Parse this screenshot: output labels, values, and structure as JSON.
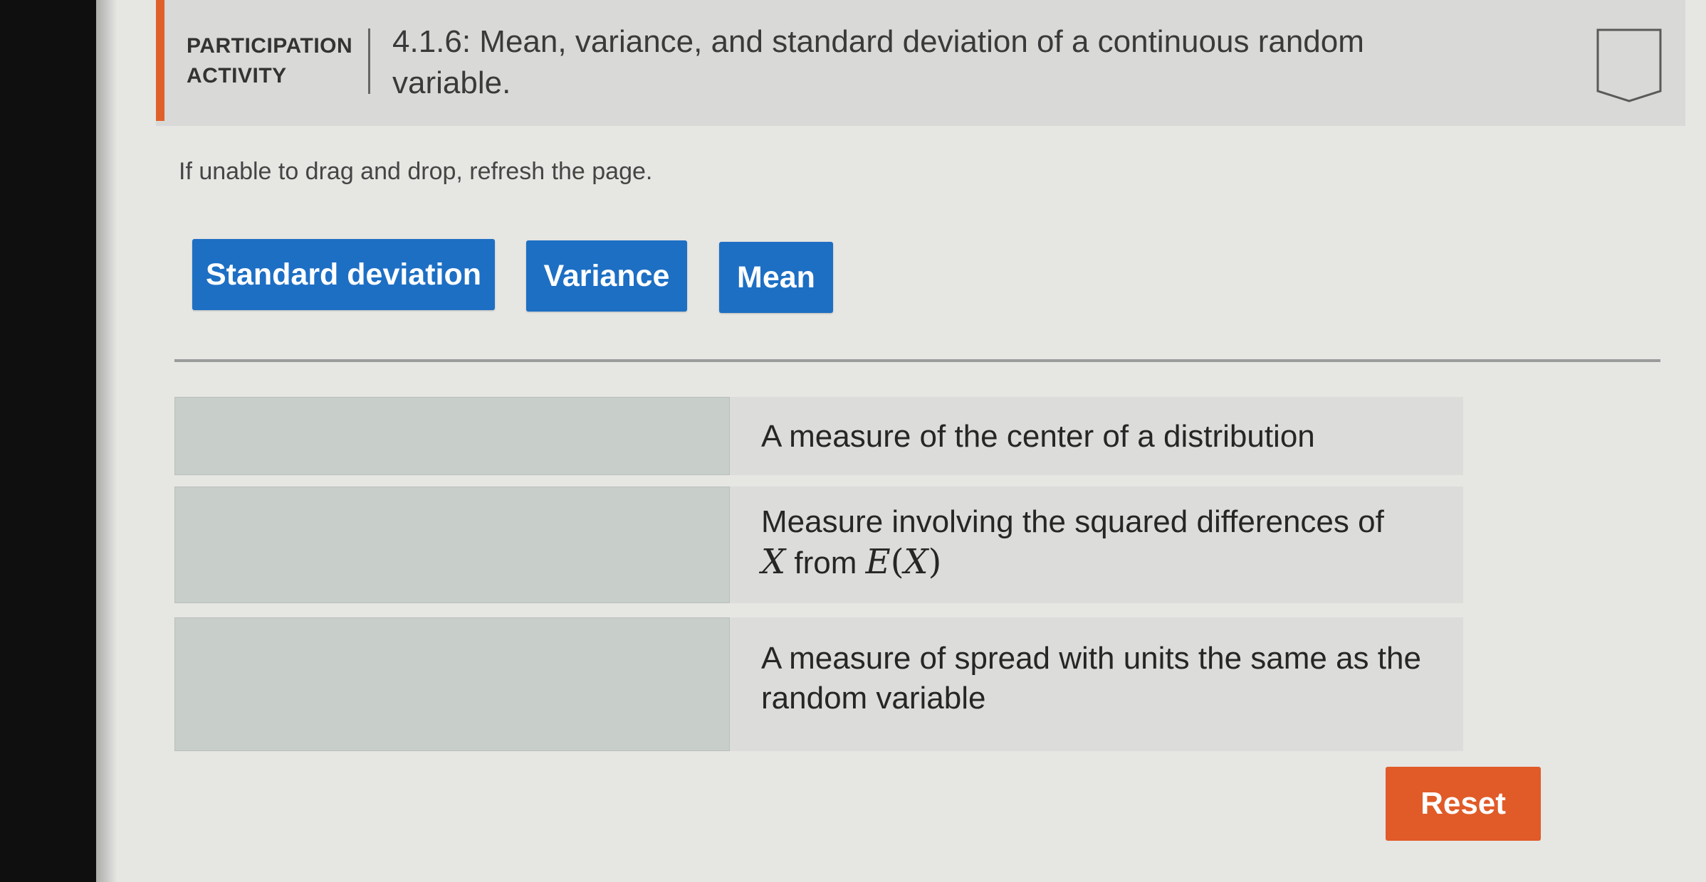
{
  "header": {
    "label_line1": "PARTICIPATION",
    "label_line2": "ACTIVITY",
    "title": "4.1.6: Mean, variance, and standard deviation of a continuous random variable."
  },
  "instructions": "If unable to drag and drop, refresh the page.",
  "terms": [
    "Standard deviation",
    "Variance",
    "Mean"
  ],
  "definitions": [
    {
      "text": "A measure of the center of a distribution"
    },
    {
      "text_pre": "Measure involving the squared differences of",
      "var_x": "X",
      "text_mid": "from",
      "expectation": "E",
      "paren_open": "(",
      "paren_close": ")"
    },
    {
      "text": "A measure of spread with units the same as the random variable"
    }
  ],
  "reset_label": "Reset",
  "colors": {
    "term_bg": "#1d6fc4",
    "reset_bg": "#e05b28",
    "accent": "#e0602a"
  },
  "icons": {
    "bookmark": "bookmark-icon"
  }
}
